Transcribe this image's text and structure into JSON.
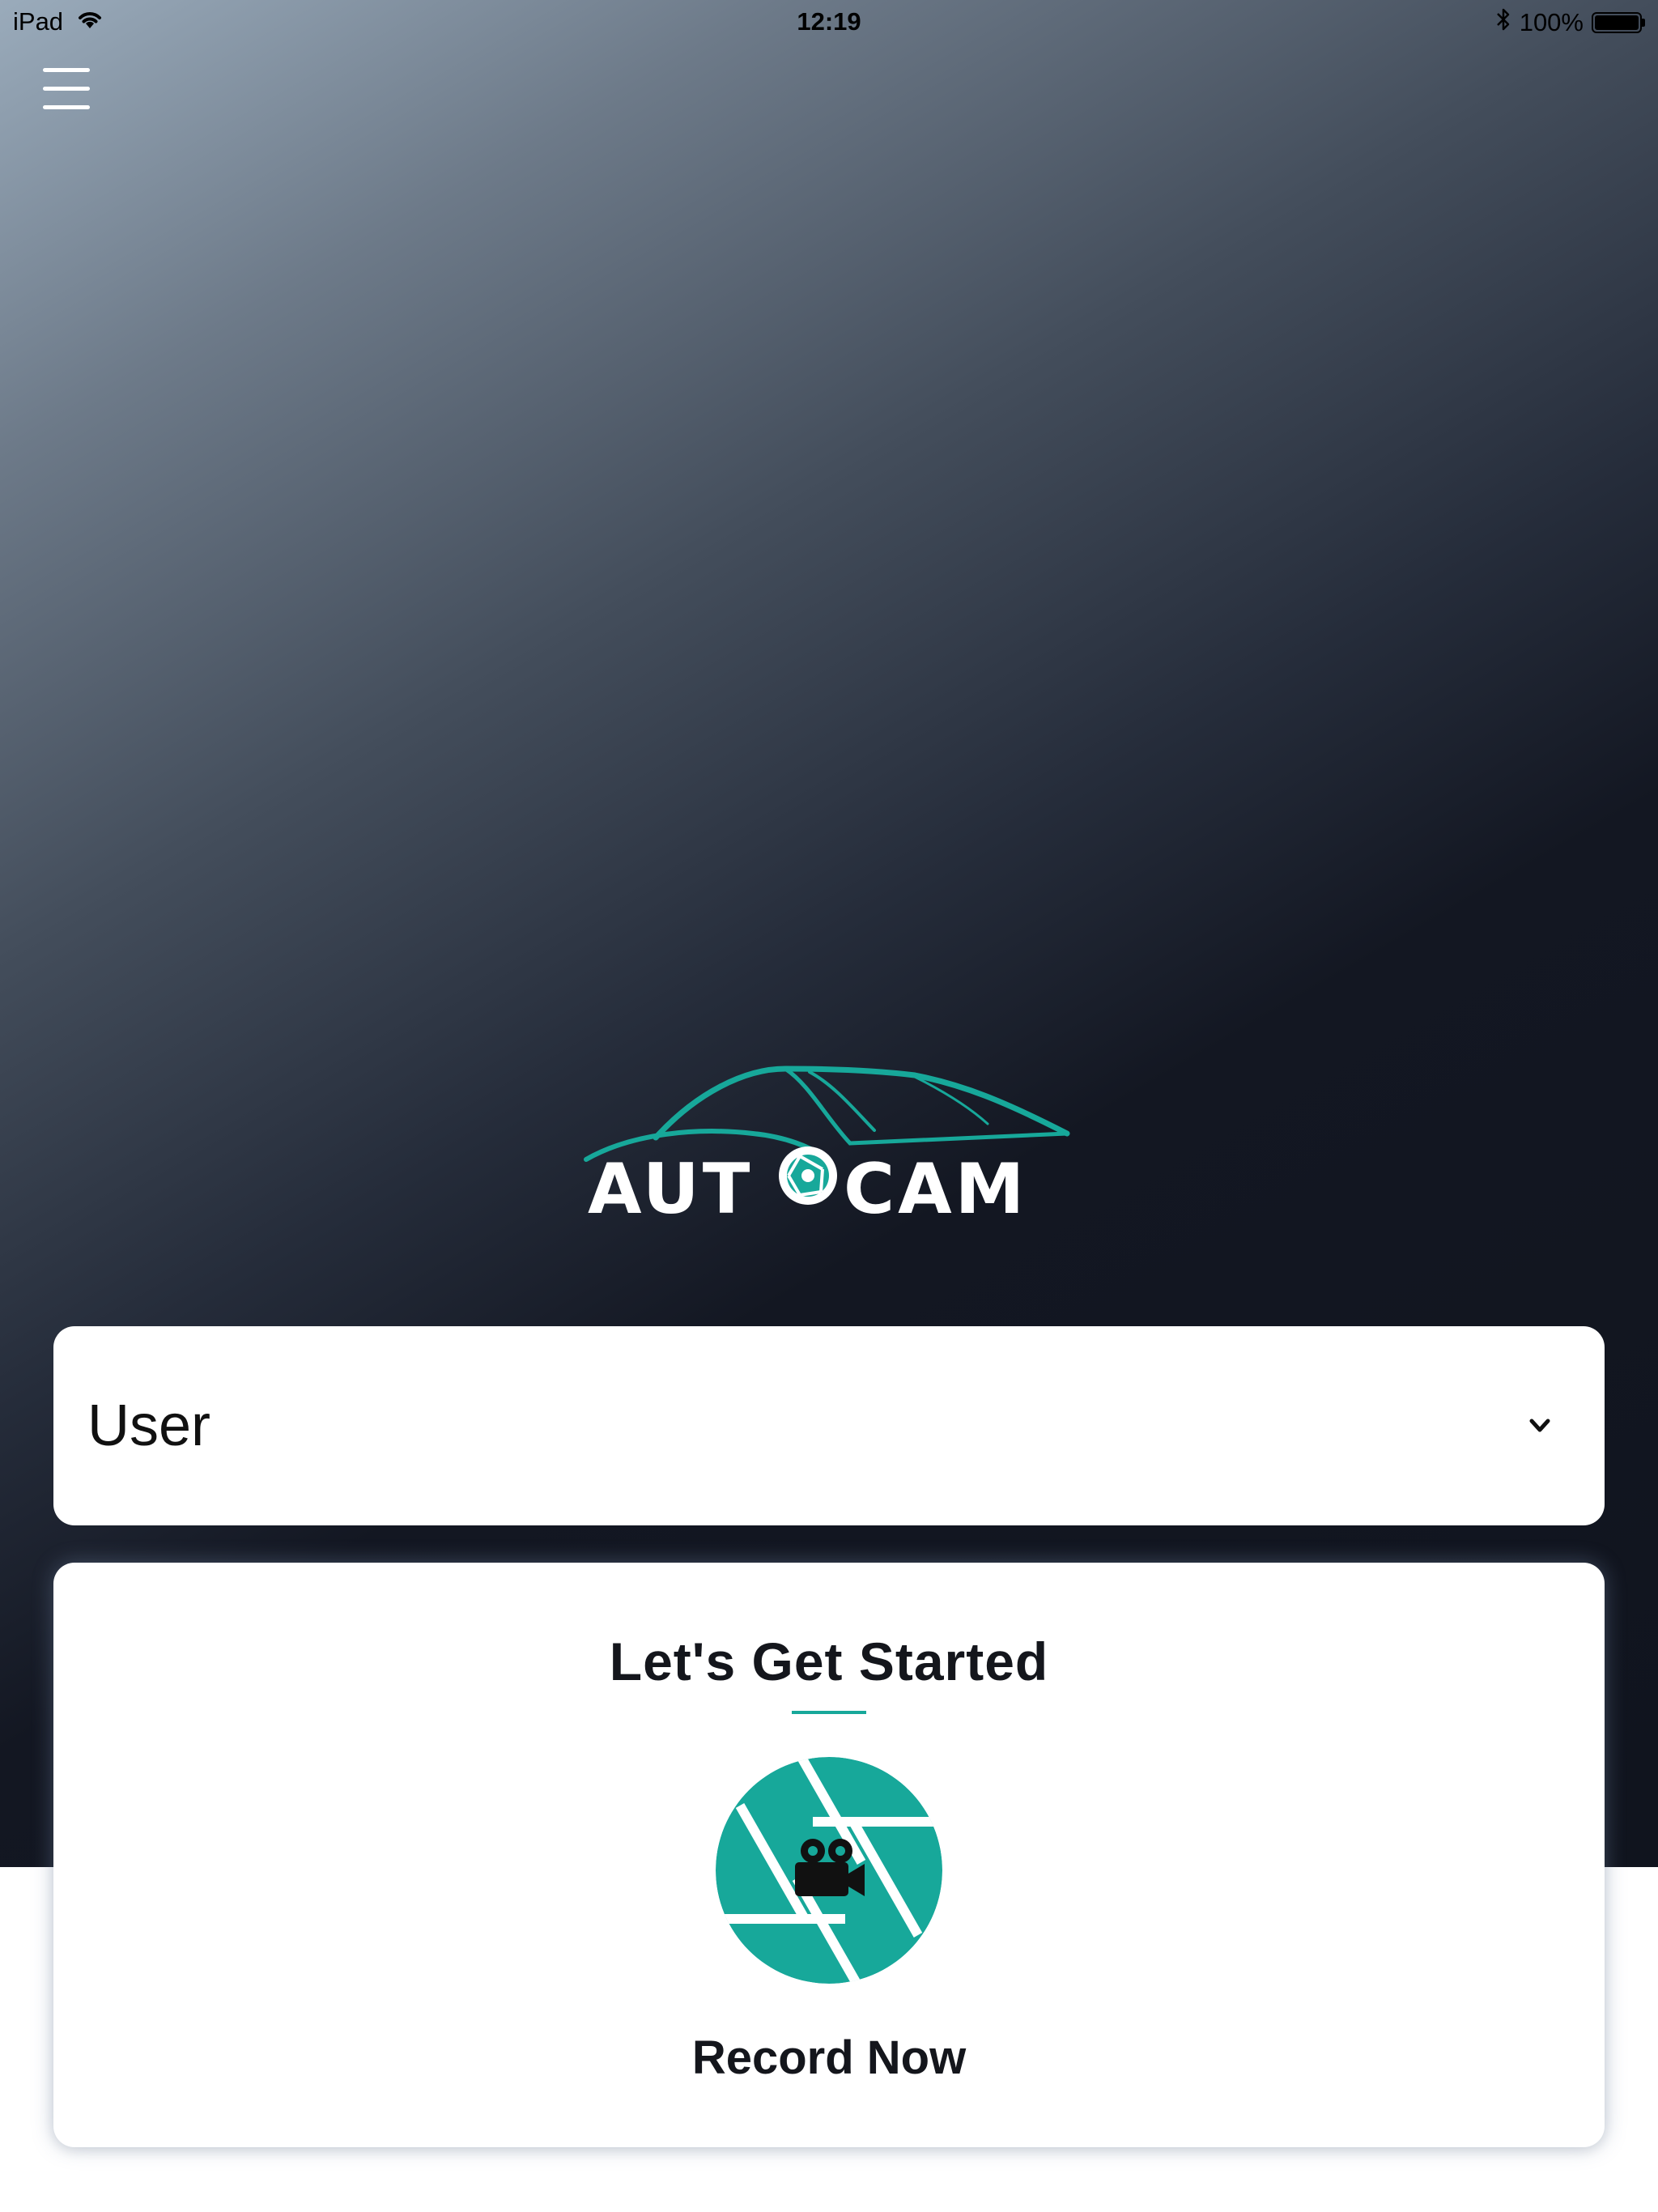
{
  "status_bar": {
    "device": "iPad",
    "time": "12:19",
    "battery_percent": "100%",
    "battery_level": 1.0,
    "icons": [
      "wifi-icon",
      "bluetooth-icon",
      "battery-icon"
    ]
  },
  "header": {
    "menu_icon": "hamburger-menu-icon"
  },
  "logo": {
    "text_before": "AUT",
    "text_after": "CAM",
    "icon": "car-silhouette-logo"
  },
  "user_select": {
    "selected_value": "User",
    "icon": "chevron-down-icon"
  },
  "start_card": {
    "title": "Let's Get Started",
    "action_label": "Record Now",
    "action_icon": "shutter-video-camera-icon"
  },
  "colors": {
    "accent": "#17a89a",
    "hero_dark": "#10141e",
    "hero_light": "#9aabbb",
    "card_bg": "#ffffff",
    "text_dark": "#14161c"
  }
}
